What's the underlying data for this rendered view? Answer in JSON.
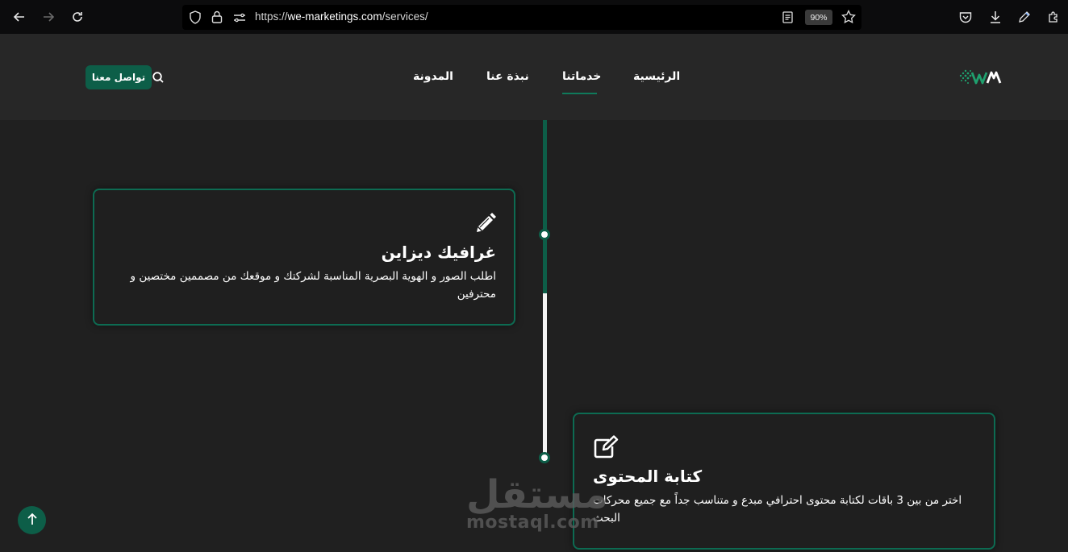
{
  "browser": {
    "url_prefix": "https://",
    "url_host": "we-marketings.com",
    "url_path": "/services/",
    "zoom": "90%",
    "icons": [
      "back-icon",
      "forward-icon",
      "reload-icon",
      "shield-icon",
      "lock-icon",
      "tracking-icon",
      "reader-icon",
      "star-icon",
      "pocket-icon",
      "download-icon",
      "pen-icon",
      "extensions-icon"
    ]
  },
  "header": {
    "contact_button": "تواصل معنا",
    "nav": [
      {
        "label": "الرئيسية",
        "active": false
      },
      {
        "label": "خدماتنا",
        "active": true
      },
      {
        "label": "نبذة عنا",
        "active": false
      },
      {
        "label": "المدونة",
        "active": false
      }
    ],
    "accent": "#0d5e48"
  },
  "cards": [
    {
      "title": "غرافيك ديزاين",
      "description": "اطلب الصور و الهوية البصرية المناسبة لشركتك و موقعك من مصممين مختصين و محترفين",
      "icon": "pencil-icon"
    },
    {
      "title": "كتابة المحتوى",
      "description": "اختر من بين 3 باقات لكتابة محتوى احترافي مبدع و متناسب جداً مع جميع محركات البحث",
      "icon": "edit-icon"
    }
  ],
  "watermark": {
    "arabic": "مستقل",
    "latin": "mostaql.com"
  }
}
